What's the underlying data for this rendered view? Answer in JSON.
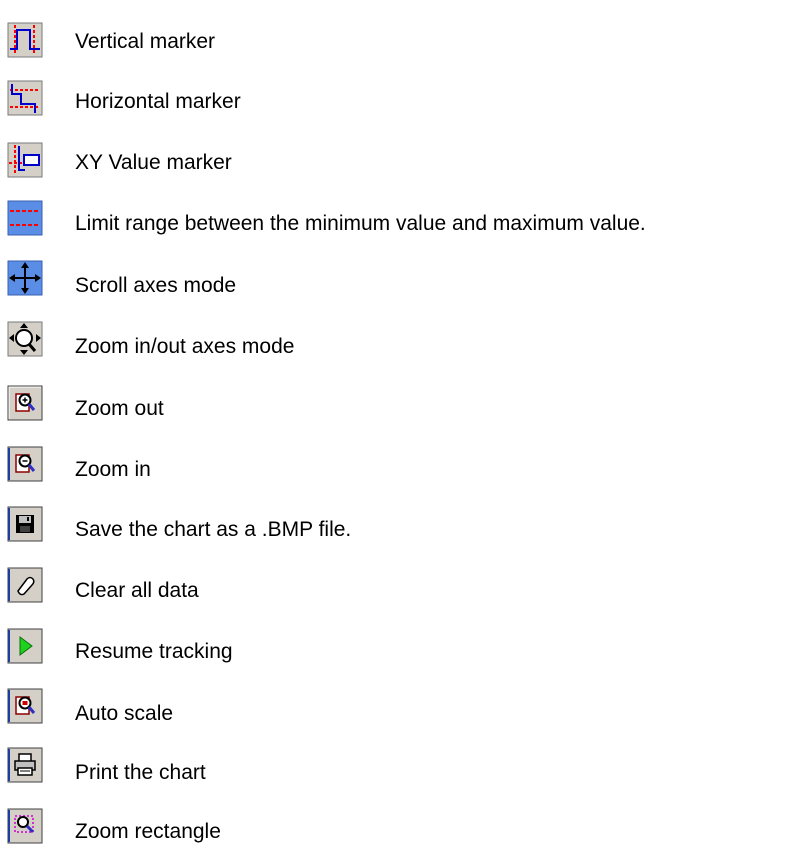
{
  "legend": {
    "items": [
      {
        "icon": "vertical-marker-icon",
        "label": "Vertical marker"
      },
      {
        "icon": "horizontal-marker-icon",
        "label": "Horizontal marker"
      },
      {
        "icon": "xy-value-marker-icon",
        "label": "XY Value marker"
      },
      {
        "icon": "limit-range-icon",
        "label": "Limit range between the minimum value and maximum value."
      },
      {
        "icon": "scroll-axes-icon",
        "label": "Scroll axes mode"
      },
      {
        "icon": "zoom-axes-icon",
        "label": "Zoom in/out axes mode"
      },
      {
        "icon": "zoom-out-icon",
        "label": "Zoom out"
      },
      {
        "icon": "zoom-in-icon",
        "label": "Zoom in"
      },
      {
        "icon": "save-disk-icon",
        "label": "Save the chart as a .BMP file."
      },
      {
        "icon": "eraser-icon",
        "label": "Clear all data"
      },
      {
        "icon": "play-icon",
        "label": "Resume tracking"
      },
      {
        "icon": "auto-scale-icon",
        "label": "Auto scale"
      },
      {
        "icon": "printer-icon",
        "label": "Print the chart"
      },
      {
        "icon": "zoom-rectangle-icon",
        "label": "Zoom rectangle"
      }
    ]
  },
  "colors": {
    "button_face": "#d4d0c8",
    "marker_red": "#ff0000",
    "marker_blue": "#0000cc",
    "active_blue": "#5a8ee6",
    "play_green": "#1fd01f"
  }
}
